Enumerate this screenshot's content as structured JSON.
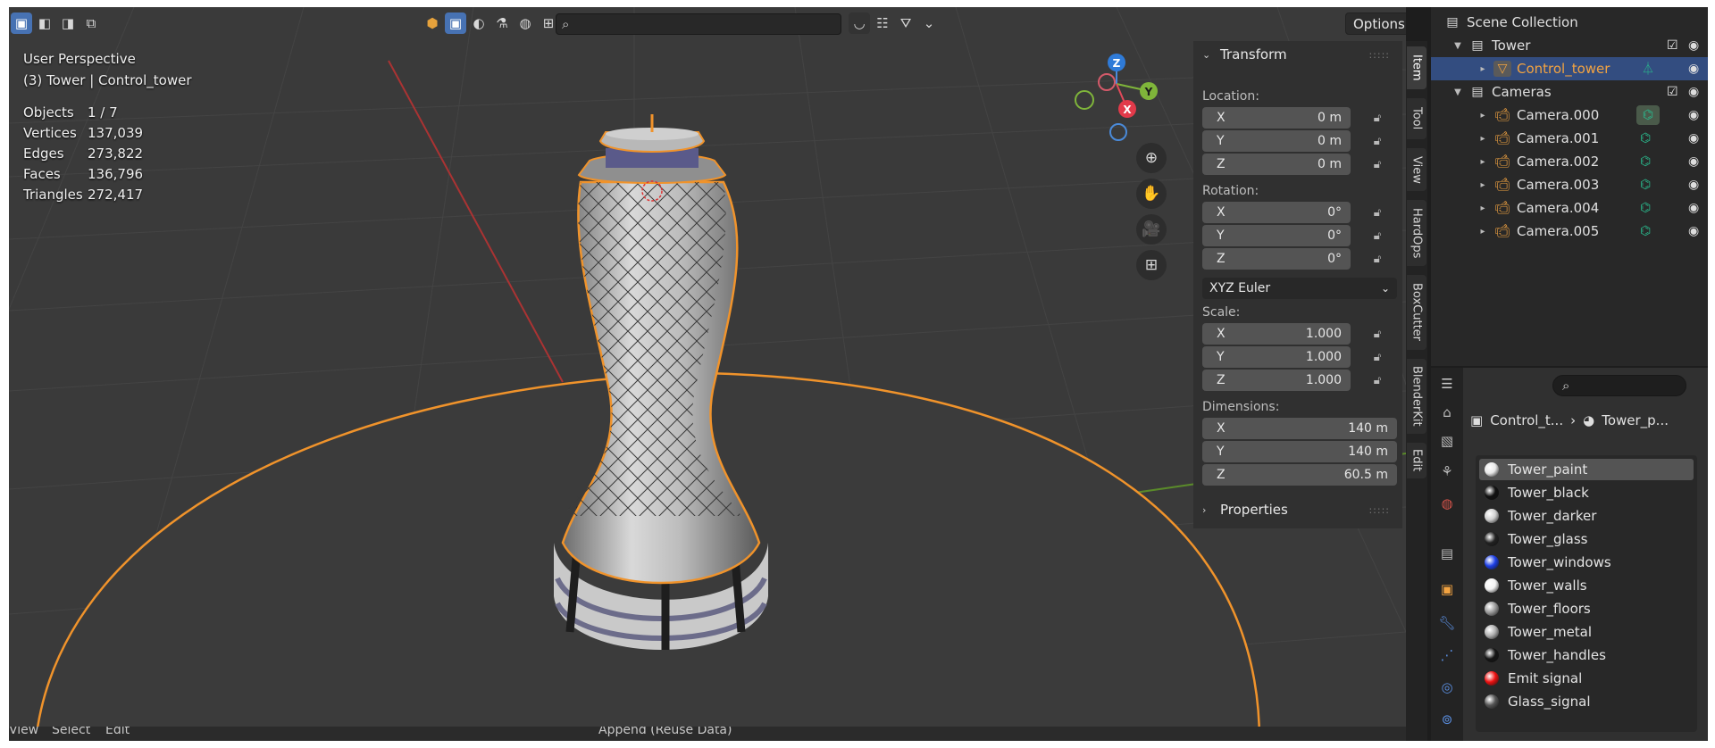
{
  "viewport": {
    "info_line1": "User Perspective",
    "info_line2": "(3) Tower | Control_tower",
    "stats": [
      {
        "label": "Objects",
        "value": "1 / 7"
      },
      {
        "label": "Vertices",
        "value": "137,039"
      },
      {
        "label": "Edges",
        "value": "273,822"
      },
      {
        "label": "Faces",
        "value": "136,796"
      },
      {
        "label": "Triangles",
        "value": "272,417"
      }
    ],
    "options_label": "Options",
    "gizmo_axes": {
      "z": "Z",
      "y": "Y",
      "x": "X"
    },
    "bottom_items": [
      "View",
      "Select",
      "Edit",
      "Append (Reuse Data)"
    ]
  },
  "npanel": {
    "transform_title": "Transform",
    "location_label": "Location:",
    "location": [
      {
        "axis": "X",
        "value": "0 m"
      },
      {
        "axis": "Y",
        "value": "0 m"
      },
      {
        "axis": "Z",
        "value": "0 m"
      }
    ],
    "rotation_label": "Rotation:",
    "rotation": [
      {
        "axis": "X",
        "value": "0°"
      },
      {
        "axis": "Y",
        "value": "0°"
      },
      {
        "axis": "Z",
        "value": "0°"
      }
    ],
    "rotation_mode": "XYZ Euler",
    "scale_label": "Scale:",
    "scale": [
      {
        "axis": "X",
        "value": "1.000"
      },
      {
        "axis": "Y",
        "value": "1.000"
      },
      {
        "axis": "Z",
        "value": "1.000"
      }
    ],
    "dimensions_label": "Dimensions:",
    "dimensions": [
      {
        "axis": "X",
        "value": "140 m"
      },
      {
        "axis": "Y",
        "value": "140 m"
      },
      {
        "axis": "Z",
        "value": "60.5 m"
      }
    ],
    "properties_title": "Properties"
  },
  "vtabs": [
    "Item",
    "Tool",
    "View",
    "HardOps",
    "BoxCutter",
    "BlenderKit",
    "Edit"
  ],
  "outliner": {
    "scene_collection": "Scene Collection",
    "tower_collection": "Tower",
    "control_tower": "Control_tower",
    "cameras_collection": "Cameras",
    "cameras": [
      "Camera.000",
      "Camera.001",
      "Camera.002",
      "Camera.003",
      "Camera.004",
      "Camera.005"
    ]
  },
  "properties": {
    "breadcrumb_object": "Control_t...",
    "breadcrumb_material": "Tower_p...",
    "materials": [
      {
        "name": "Tower_paint",
        "color": "#e8e8e8"
      },
      {
        "name": "Tower_black",
        "color": "#111111"
      },
      {
        "name": "Tower_darker",
        "color": "#d0d0d0"
      },
      {
        "name": "Tower_glass",
        "color": "#222222"
      },
      {
        "name": "Tower_windows",
        "color": "#1d3fe6"
      },
      {
        "name": "Tower_walls",
        "color": "#f2f2f2"
      },
      {
        "name": "Tower_floors",
        "color": "#9a9a9a"
      },
      {
        "name": "Tower_metal",
        "color": "#b0b0b0"
      },
      {
        "name": "Tower_handles",
        "color": "#151515"
      },
      {
        "name": "Emit signal",
        "color": "#ee1111"
      },
      {
        "name": "Glass_signal",
        "color": "#555555"
      }
    ]
  },
  "colors": {
    "selection_outline": "#f0932b",
    "accent": "#4772b3",
    "object_orange": "#f2a341",
    "camera_green": "#2ab78c"
  }
}
